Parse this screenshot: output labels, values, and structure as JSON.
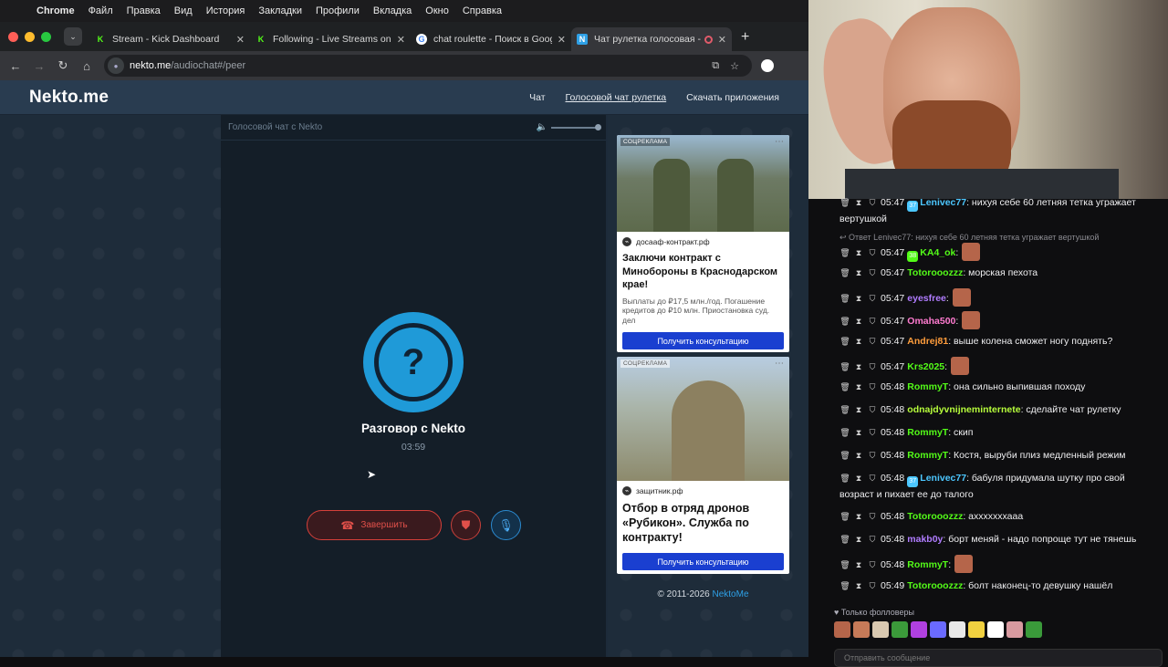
{
  "menubar": {
    "apple": "",
    "app": "Chrome",
    "items": [
      "Файл",
      "Правка",
      "Вид",
      "История",
      "Закладки",
      "Профили",
      "Вкладка",
      "Окно",
      "Справка"
    ]
  },
  "tabs": [
    {
      "title": "Stream - Kick Dashboard",
      "favicon": "K",
      "color": "#53fc18",
      "active": false
    },
    {
      "title": "Following - Live Streams on K",
      "favicon": "K",
      "color": "#53fc18",
      "active": false
    },
    {
      "title": "chat roulette - Поиск в Goog",
      "favicon": "G",
      "color": "#4285f4",
      "active": false
    },
    {
      "title": "Чат рулетка голосовая -",
      "favicon": "N",
      "color": "#2ea0e6",
      "active": true
    }
  ],
  "address": {
    "host": "nekto.me",
    "path": "/audiochat#/peer"
  },
  "site": {
    "logo": "Nekto.me",
    "nav": [
      "Чат",
      "Голосовой чат рулетка",
      "Скачать приложения"
    ]
  },
  "call": {
    "panel_title": "Голосовой чат с Nekto",
    "avatar_symbol": "?",
    "title": "Разговор с Nekto",
    "time": "03:59",
    "end_label": "Завершить"
  },
  "ads": [
    {
      "label": "СОЦРЕКЛАМА",
      "source": "досааф-контракт.рф",
      "headline": "Заключи контракт с Минобороны в Краснодарском крае!",
      "desc": "Выплаты до ₽17,5 млн./год. Погашение кредитов до ₽10 млн. Приостановка суд. дел",
      "cta": "Получить консультацию"
    },
    {
      "label": "СОЦРЕКЛАМА",
      "source": "защитник.рф",
      "headline": "Отбор в отряд дронов «Рубикон». Служба по контракту!",
      "desc": "",
      "cta": "Получить консультацию"
    }
  ],
  "copyright": {
    "text": "© 2011-2026",
    "brand": "NektoMe"
  },
  "twitch": {
    "messages": [
      {
        "time": "05:47",
        "name": "Lenivec77",
        "color": "#4cc7ff",
        "badge": "37",
        "text": ": нихуя себе 60 летняя тетка угражает вертушкой",
        "emote": false
      },
      {
        "time": "05:47",
        "name": "KA4_ok",
        "color": "#53fc18",
        "badge": "38",
        "text": ":",
        "emote": true
      },
      {
        "time": "05:47",
        "name": "Totorooozzz",
        "color": "#53fc18",
        "badge": "",
        "text": ": морская пехота",
        "emote": false
      },
      {
        "time": "05:47",
        "name": "eyesfree",
        "color": "#b07cff",
        "badge": "",
        "text": ":",
        "emote": true
      },
      {
        "time": "05:47",
        "name": "Omaha500",
        "color": "#ff7bd0",
        "badge": "",
        "text": ":",
        "emote": true
      },
      {
        "time": "05:47",
        "name": "Andrej81",
        "color": "#ff9d3c",
        "badge": "",
        "text": ": выше колена сможет ногу поднять?",
        "emote": false
      },
      {
        "time": "05:47",
        "name": "Krs2025",
        "color": "#53fc18",
        "badge": "",
        "text": ":",
        "emote": true
      },
      {
        "time": "05:48",
        "name": "RommyT",
        "color": "#53fc18",
        "badge": "",
        "text": ": она сильно выпившая походу",
        "emote": false
      },
      {
        "time": "05:48",
        "name": "odnajdyvnijneminternete",
        "color": "#b8ff3c",
        "badge": "",
        "text": ": сделайте чат рулетку",
        "emote": false
      },
      {
        "time": "05:48",
        "name": "RommyT",
        "color": "#53fc18",
        "badge": "",
        "text": ": скип",
        "emote": false
      },
      {
        "time": "05:48",
        "name": "RommyT",
        "color": "#53fc18",
        "badge": "",
        "text": ": Костя, выруби плиз медленный режим",
        "emote": false
      },
      {
        "time": "05:48",
        "name": "Lenivec77",
        "color": "#4cc7ff",
        "badge": "37",
        "text": ": бабуля придумала шутку про свой возраст и пихает ее до талого",
        "emote": false
      },
      {
        "time": "05:48",
        "name": "Totorooozzz",
        "color": "#53fc18",
        "badge": "",
        "text": ": ахххххххааа",
        "emote": false
      },
      {
        "time": "05:48",
        "name": "makb0y",
        "color": "#b07cff",
        "badge": "",
        "text": ": борт меняй - надо попроще тут не тянешь",
        "emote": false
      },
      {
        "time": "05:48",
        "name": "RommyT",
        "color": "#53fc18",
        "badge": "",
        "text": ":",
        "emote": true
      },
      {
        "time": "05:49",
        "name": "Totorooozzz",
        "color": "#53fc18",
        "badge": "",
        "text": ": болт наконец-то девушку нашёл",
        "emote": false
      }
    ],
    "reply_text": "Ответ Lenivec77: нихуя себе 60 летняя тетка угражает вертушкой",
    "followers_label": "Только фолловеры",
    "input_placeholder": "Отправить сообщение"
  }
}
